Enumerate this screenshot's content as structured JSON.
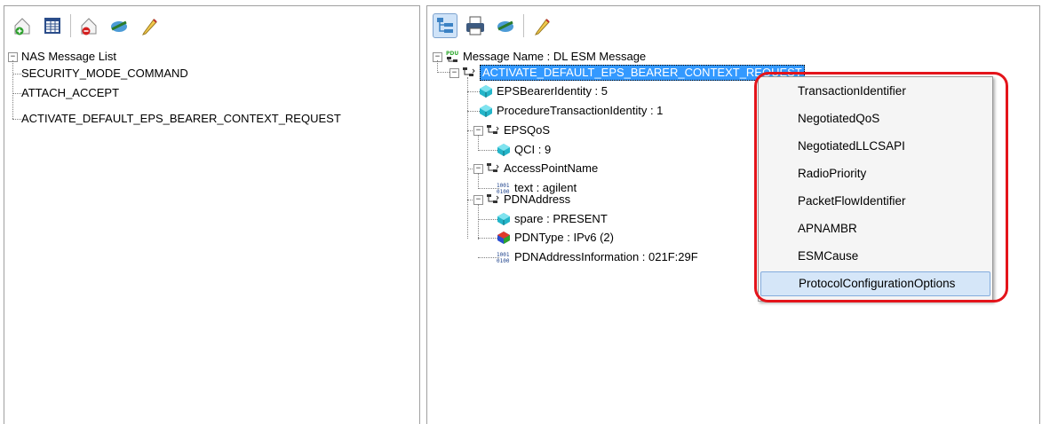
{
  "left_tree": {
    "root_label": "NAS Message List",
    "items": [
      "SECURITY_MODE_COMMAND",
      "ATTACH_ACCEPT",
      "ACTIVATE_DEFAULT_EPS_BEARER_CONTEXT_REQUEST"
    ]
  },
  "right_tree": {
    "root_label": "Message Name : DL ESM Message",
    "message_node": "ACTIVATE_DEFAULT_EPS_BEARER_CONTEXT_REQUEST",
    "eps_bearer_identity": "EPSBearerIdentity : 5",
    "procedure_transaction_identity": "ProcedureTransactionIdentity : 1",
    "eps_qos": "EPSQoS",
    "qci": "QCI : 9",
    "access_point_name": "AccessPointName",
    "apn_text": "text : agilent",
    "pdn_address": "PDNAddress",
    "spare": "spare : PRESENT",
    "pdn_type": "PDNType : IPv6 (2)",
    "pdn_address_information": "PDNAddressInformation : 021F:29F"
  },
  "context_menu": {
    "items": [
      "TransactionIdentifier",
      "NegotiatedQoS",
      "NegotiatedLLCSAPI",
      "RadioPriority",
      "PacketFlowIdentifier",
      "APNAMBR",
      "ESMCause",
      "ProtocolConfigurationOptions"
    ],
    "highlighted": "ProtocolConfigurationOptions"
  },
  "icons": {
    "left_toolbar": [
      "add-tab-icon",
      "table-icon",
      "remove-tab-icon",
      "send-icon",
      "edit-icon"
    ],
    "right_toolbar": [
      "tree-view-icon",
      "print-icon",
      "send-icon",
      "edit-icon"
    ]
  },
  "colors": {
    "selection": "#3399ff",
    "highlight_box": "#e4141b",
    "menu_highlight": "#d5e6f8"
  }
}
